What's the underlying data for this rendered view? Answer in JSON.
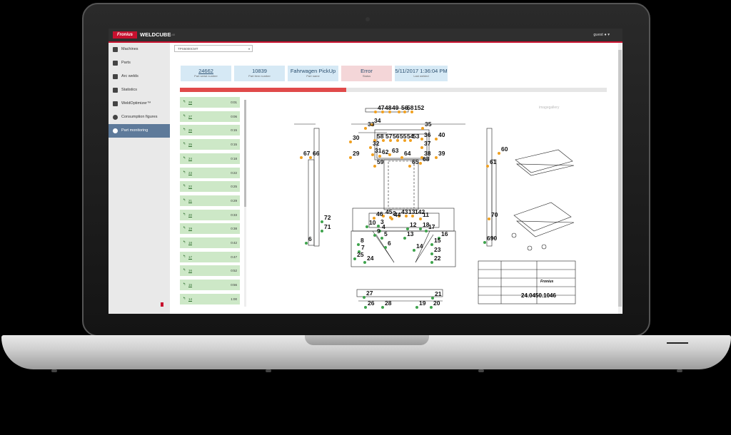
{
  "app": {
    "brand": "Fronius",
    "title": "WELDCUBE",
    "version": "v1.9.40",
    "user": "guest"
  },
  "sidebar": {
    "items": [
      {
        "label": "Machines",
        "icon": "machine-icon"
      },
      {
        "label": "Parts",
        "icon": "parts-icon"
      },
      {
        "label": "Arc welds",
        "icon": "arc-weld-icon"
      },
      {
        "label": "Statistics",
        "icon": "statistics-icon"
      },
      {
        "label": "WeldOptimizer™",
        "icon": "rocket-icon"
      },
      {
        "label": "Consumption figures",
        "icon": "pie-chart-icon"
      },
      {
        "label": "Part monitoring",
        "icon": "magnifier-icon",
        "active": true
      }
    ]
  },
  "machine_select": {
    "value": "TPS5000CMT"
  },
  "summary": [
    {
      "value": "24662",
      "label": "Part serial number"
    },
    {
      "value": "10839",
      "label": "Part item number"
    },
    {
      "value": "Fahrwagen PickUp",
      "label": "Part name"
    },
    {
      "value": "Error",
      "label": "Status"
    },
    {
      "value": "5/11/2017 1:36:04 PM",
      "label": "Last welded"
    }
  ],
  "progress": {
    "fraction": 0.39,
    "color": "#e04a4a"
  },
  "seams": [
    {
      "id": "28",
      "time": "0:01"
    },
    {
      "id": "27",
      "time": "0:06"
    },
    {
      "id": "26",
      "time": "0:15"
    },
    {
      "id": "25",
      "time": "0:15"
    },
    {
      "id": "24",
      "time": "0:18"
    },
    {
      "id": "23",
      "time": "0:22"
    },
    {
      "id": "22",
      "time": "0:25"
    },
    {
      "id": "21",
      "time": "0:29"
    },
    {
      "id": "20",
      "time": "0:33"
    },
    {
      "id": "19",
      "time": "0:38"
    },
    {
      "id": "18",
      "time": "0:42"
    },
    {
      "id": "17",
      "time": "0:47"
    },
    {
      "id": "16",
      "time": "0:52"
    },
    {
      "id": "15",
      "time": "0:56"
    },
    {
      "id": "14",
      "time": "1:00"
    }
  ],
  "drawing": {
    "watermark": "imagegallery",
    "drawing_number": "24.0450.1046",
    "title_block_brand": "Fronius"
  },
  "colors": {
    "brand": "#c8102e",
    "ok": "#cde8c7",
    "error": "#f4d6d8",
    "info": "#d6e9f5",
    "marker_orange": "#f0a020",
    "marker_green": "#3fa34d"
  }
}
